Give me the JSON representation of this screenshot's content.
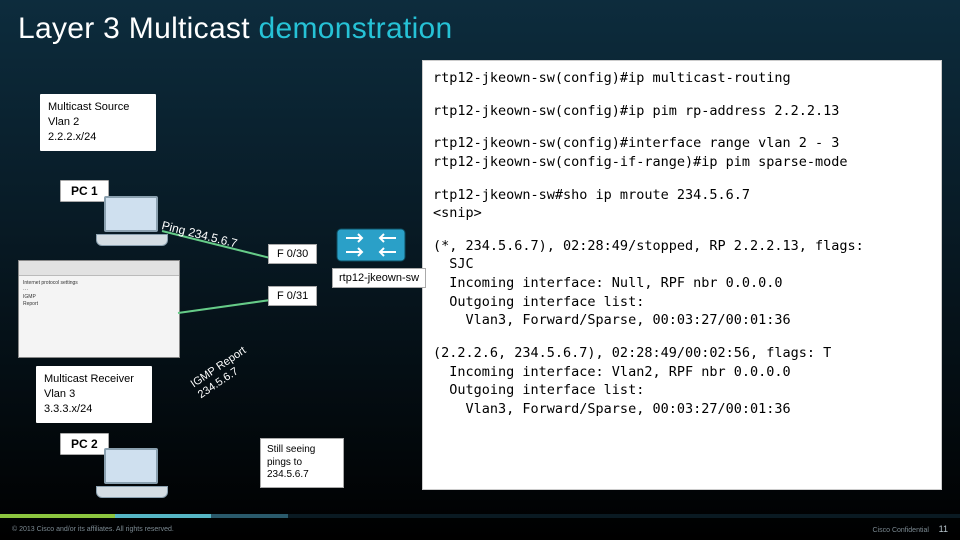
{
  "title": {
    "plain": "Layer 3 Multicast ",
    "accent": "demonstration"
  },
  "src": {
    "l1": "Multicast Source",
    "l2": "Vlan 2",
    "l3": "2.2.2.x/24"
  },
  "recv": {
    "l1": "Multicast Receiver",
    "l2": "Vlan 3",
    "l3": "3.3.3.x/24"
  },
  "pc1": "PC 1",
  "pc2": "PC 2",
  "ports": {
    "p30": "F 0/30",
    "p31": "F 0/31"
  },
  "switch_name": "rtp12-jkeown-sw",
  "ping_text": "Ping 234.5.6.7",
  "igmp_text": {
    "l1": "IGMP Report",
    "l2": "234.5.6.7"
  },
  "note": "Still seeing pings to 234.5.6.7",
  "term": {
    "b1": "rtp12-jkeown-sw(config)#ip multicast-routing",
    "b2": "rtp12-jkeown-sw(config)#ip pim rp-address 2.2.2.13",
    "b3": "rtp12-jkeown-sw(config)#interface range vlan 2 - 3\nrtp12-jkeown-sw(config-if-range)#ip pim sparse-mode",
    "b4": "rtp12-jkeown-sw#sho ip mroute 234.5.6.7\n<snip>",
    "b5": "(*, 234.5.6.7), 02:28:49/stopped, RP 2.2.2.13, flags:\n  SJC\n  Incoming interface: Null, RPF nbr 0.0.0.0\n  Outgoing interface list:\n    Vlan3, Forward/Sparse, 00:03:27/00:01:36",
    "b6": "(2.2.2.6, 234.5.6.7), 02:28:49/00:02:56, flags: T\n  Incoming interface: Vlan2, RPF nbr 0.0.0.0\n  Outgoing interface list:\n    Vlan3, Forward/Sparse, 00:03:27/00:01:36"
  },
  "footer": {
    "copyright": "© 2013  Cisco and/or its affiliates. All rights reserved.",
    "conf": "Cisco Confidential",
    "page": "11"
  }
}
